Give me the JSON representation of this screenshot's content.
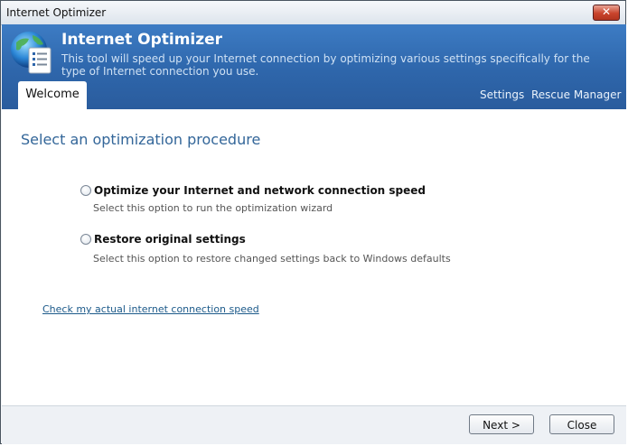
{
  "window": {
    "title": "Internet Optimizer"
  },
  "header": {
    "app_title": "Internet Optimizer",
    "description": "This tool will speed up your Internet connection by optimizing various settings specifically for the type of Internet connection you use.",
    "tabs": [
      {
        "label": "Welcome",
        "active": true
      }
    ],
    "links": {
      "settings": "Settings",
      "rescue_manager": "Rescue Manager"
    }
  },
  "main": {
    "section_title": "Select an optimization procedure",
    "options": [
      {
        "label": "Optimize your Internet and network connection speed",
        "description": "Select this option to run the optimization wizard",
        "selected": false
      },
      {
        "label": "Restore original settings",
        "description": "Select this option to restore changed settings back to Windows defaults",
        "selected": false
      }
    ],
    "check_link": "Check my actual internet connection speed"
  },
  "footer": {
    "next_label": "Next >",
    "close_label": "Close"
  }
}
